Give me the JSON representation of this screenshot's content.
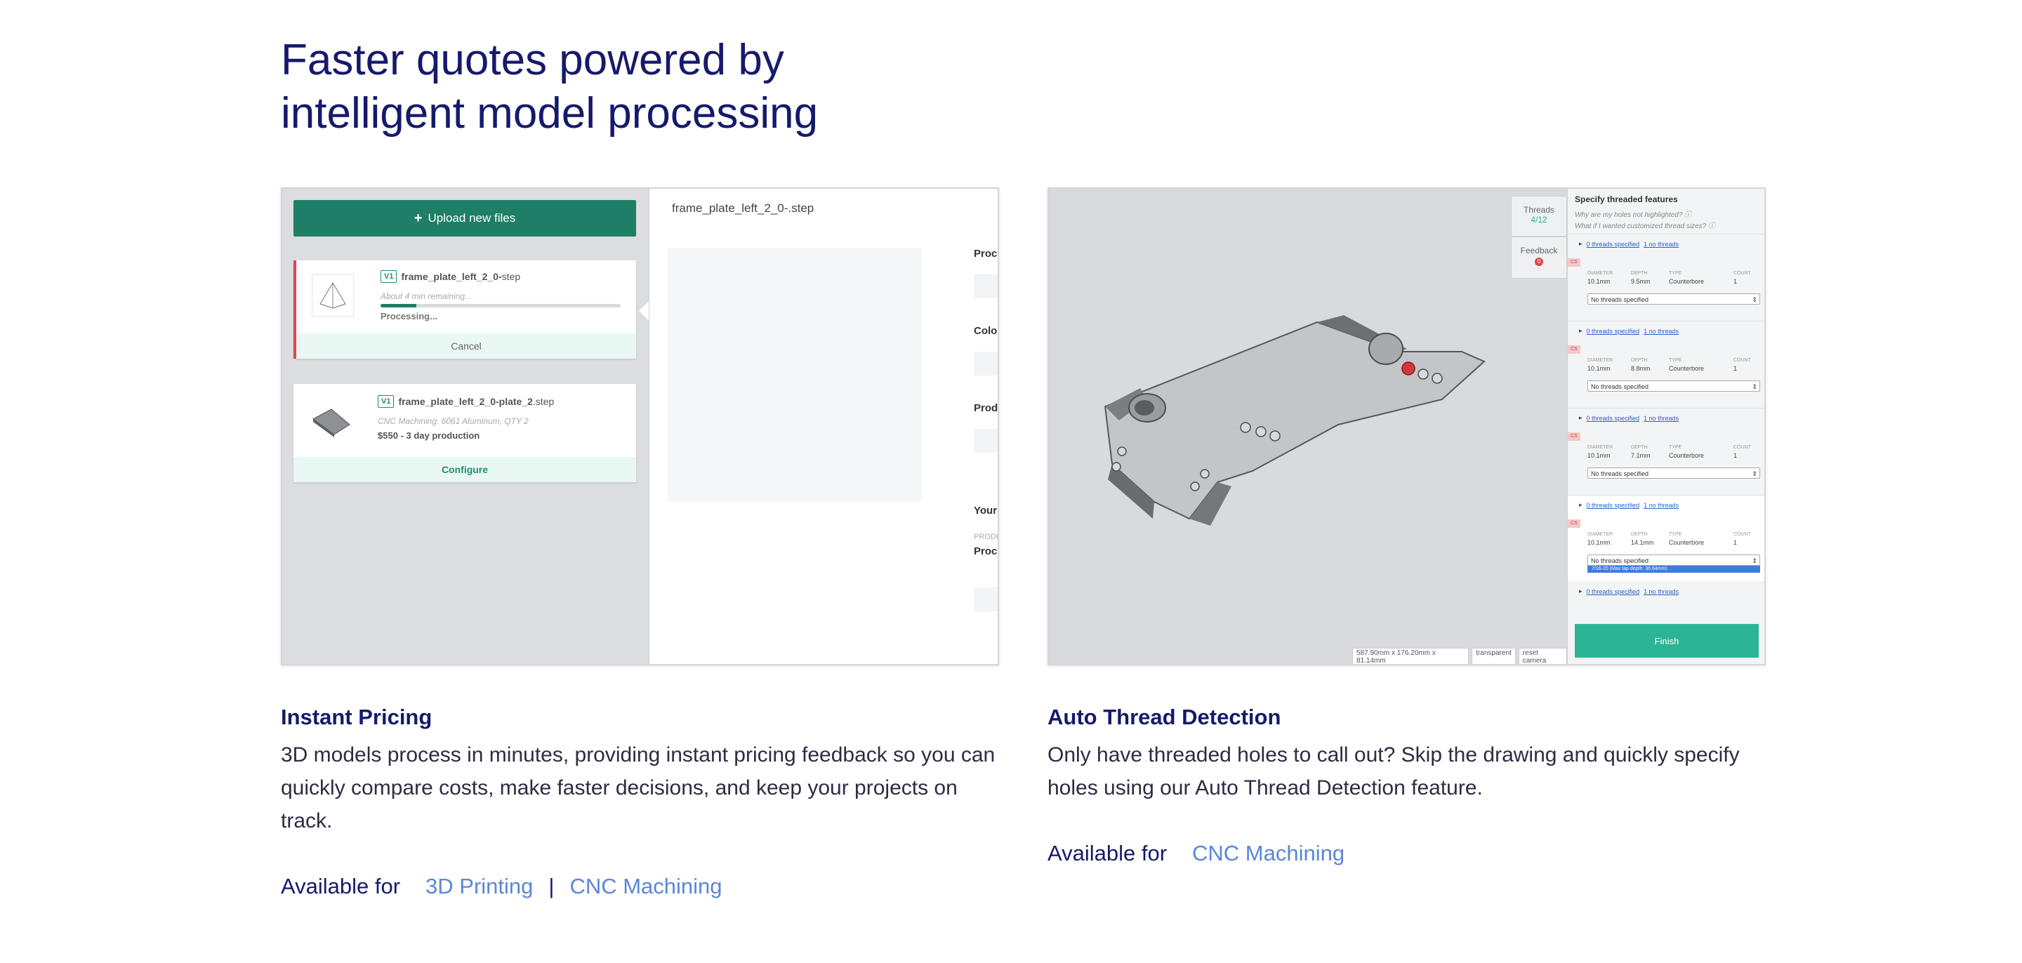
{
  "heading": {
    "line1": "Faster quotes powered by",
    "line2": "intelligent model processing"
  },
  "pricing_screenshot": {
    "upload_button": {
      "icon": "plus-icon",
      "label": "Upload new files"
    },
    "files": [
      {
        "version": "V1",
        "name_bold": "frame_plate_left_2_0-",
        "name_ext": "step",
        "status_note": "About 4 min remaining...",
        "status": "Processing...",
        "progress": 0.15,
        "action": "Cancel"
      },
      {
        "version": "V1",
        "name_bold": "frame_plate_left_2_0-plate_2",
        "name_ext": ".step",
        "details": "CNC Machining, 6061 Aluminum, QTY 2",
        "price_line": "$550  - 3 day production",
        "action": "Configure"
      }
    ],
    "preview_filename": "frame_plate_left_2_0-.step",
    "right_labels": [
      "Proce",
      "Color",
      "Produ",
      "Your",
      "PRODU",
      "Proc"
    ]
  },
  "thread_screenshot": {
    "tabs": [
      {
        "label": "Threads",
        "count": "4/12"
      },
      {
        "label": "Feedback",
        "badge": "0"
      }
    ],
    "panel_title": "Specify threaded features",
    "help_links": [
      "Why are my holes not highlighted?",
      "What if I wanted customized thread sizes?"
    ],
    "link_specified": "0 threads specified",
    "link_no_threads": "1 no threads",
    "column_labels": [
      "DIAMETER",
      "DEPTH",
      "TYPE",
      "COUNT"
    ],
    "holes": [
      {
        "badge": "CS",
        "diameter": "10.1mm",
        "depth": "9.5mm",
        "type": "Counterbore",
        "count": "1",
        "select": "No threads specified"
      },
      {
        "badge": "CS",
        "diameter": "10.1mm",
        "depth": "8.8mm",
        "type": "Counterbore",
        "count": "1",
        "select": "No threads specified"
      },
      {
        "badge": "CS",
        "diameter": "10.1mm",
        "depth": "7.1mm",
        "type": "Counterbore",
        "count": "1",
        "select": "No threads specified"
      },
      {
        "badge": "CS",
        "diameter": "10.1mm",
        "depth": "14.1mm",
        "type": "Counterbore",
        "count": "1",
        "select": "No threads specified",
        "option": "7/16-20 (Max tap depth: 36.64mm)"
      }
    ],
    "finish_button": "Finish",
    "dimensions": "587.90mm x 176.20mm x 81.14mm",
    "transparent": "transparent",
    "reset_camera": "reset camera"
  },
  "features": [
    {
      "title": "Instant Pricing",
      "description": "3D models process in minutes, providing instant pricing feedback so you can quickly compare costs, make faster decisions, and keep your projects on track.",
      "available_label": "Available for",
      "links": [
        "3D Printing",
        "CNC Machining"
      ],
      "separator": "|"
    },
    {
      "title": "Auto Thread Detection",
      "description": "Only have threaded holes to call out? Skip the drawing and quickly specify holes using our Auto Thread Detection feature.",
      "available_label": "Available for",
      "links": [
        "CNC Machining"
      ]
    }
  ],
  "colors": {
    "heading": "#151a6b",
    "link": "#5b86d9",
    "primary_green": "#1e7f66",
    "finish_teal": "#2bb596"
  }
}
